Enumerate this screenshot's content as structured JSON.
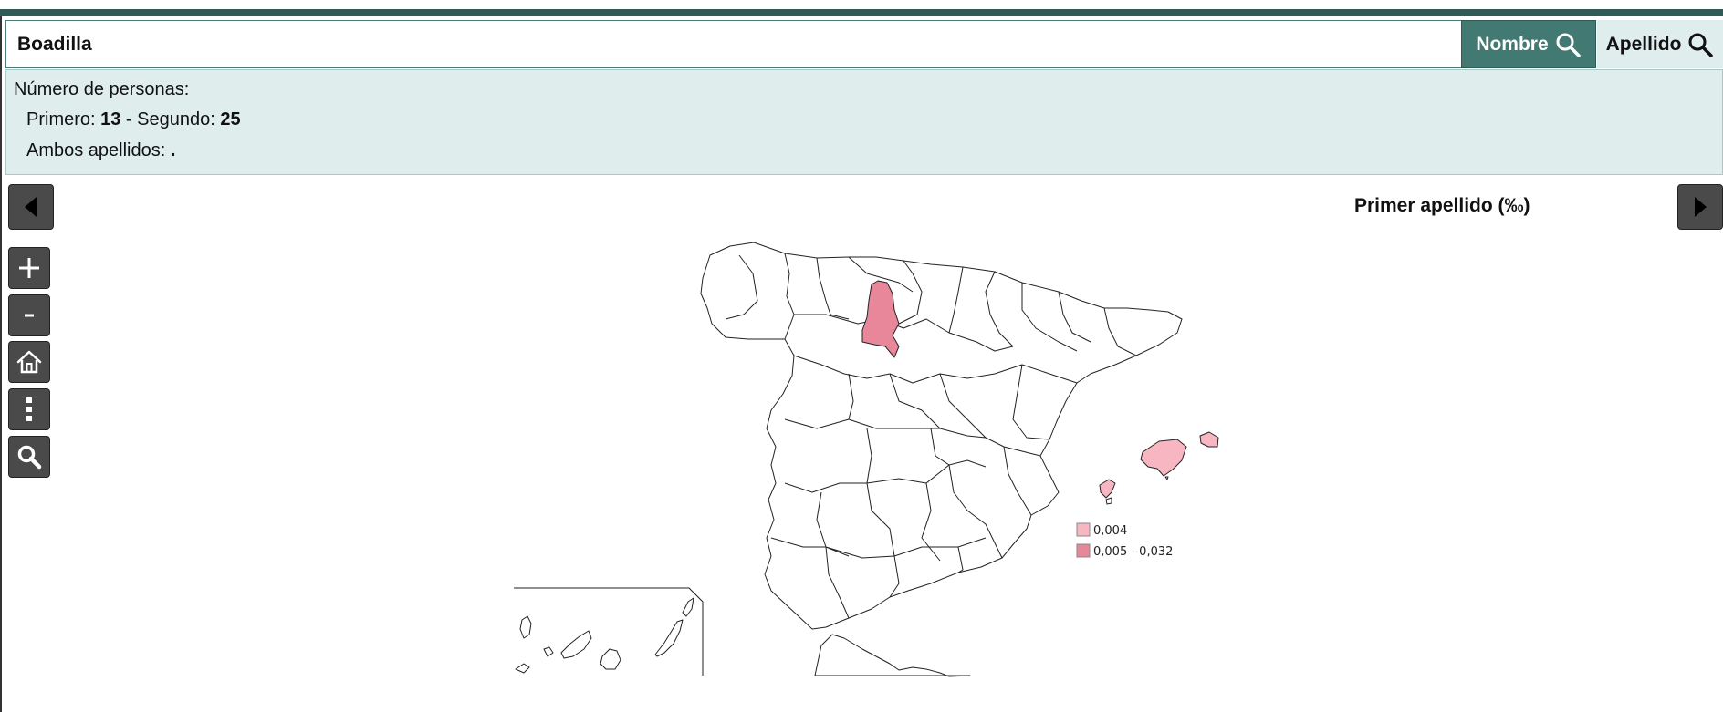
{
  "search": {
    "value": "Boadilla",
    "nombre_label": "Nombre",
    "apellido_label": "Apellido"
  },
  "info": {
    "title": "Número de personas:",
    "primero_label": "Primero: ",
    "primero_value": "13",
    "separator": " - Segundo: ",
    "segundo_value": "25",
    "ambos_label": "Ambos apellidos: ",
    "ambos_value": "."
  },
  "map": {
    "title": "Primer apellido (‰)",
    "legend": [
      {
        "label": "0,004",
        "color": "#f7b6c2"
      },
      {
        "label": "0,005 - 0,032",
        "color": "#e8879a"
      }
    ]
  },
  "controls": {
    "prev_icon": "triangle-left-icon",
    "next_icon": "triangle-right-icon",
    "zoom_in_icon": "plus-icon",
    "zoom_out_icon": "minus-icon",
    "home_icon": "home-icon",
    "more_icon": "vertical-dots-icon",
    "search_icon": "magnifier-icon"
  },
  "colors": {
    "accent": "#427a73",
    "panel": "#dfeeed",
    "highlight_high": "#e8879a",
    "highlight_low": "#f7b6c2"
  }
}
